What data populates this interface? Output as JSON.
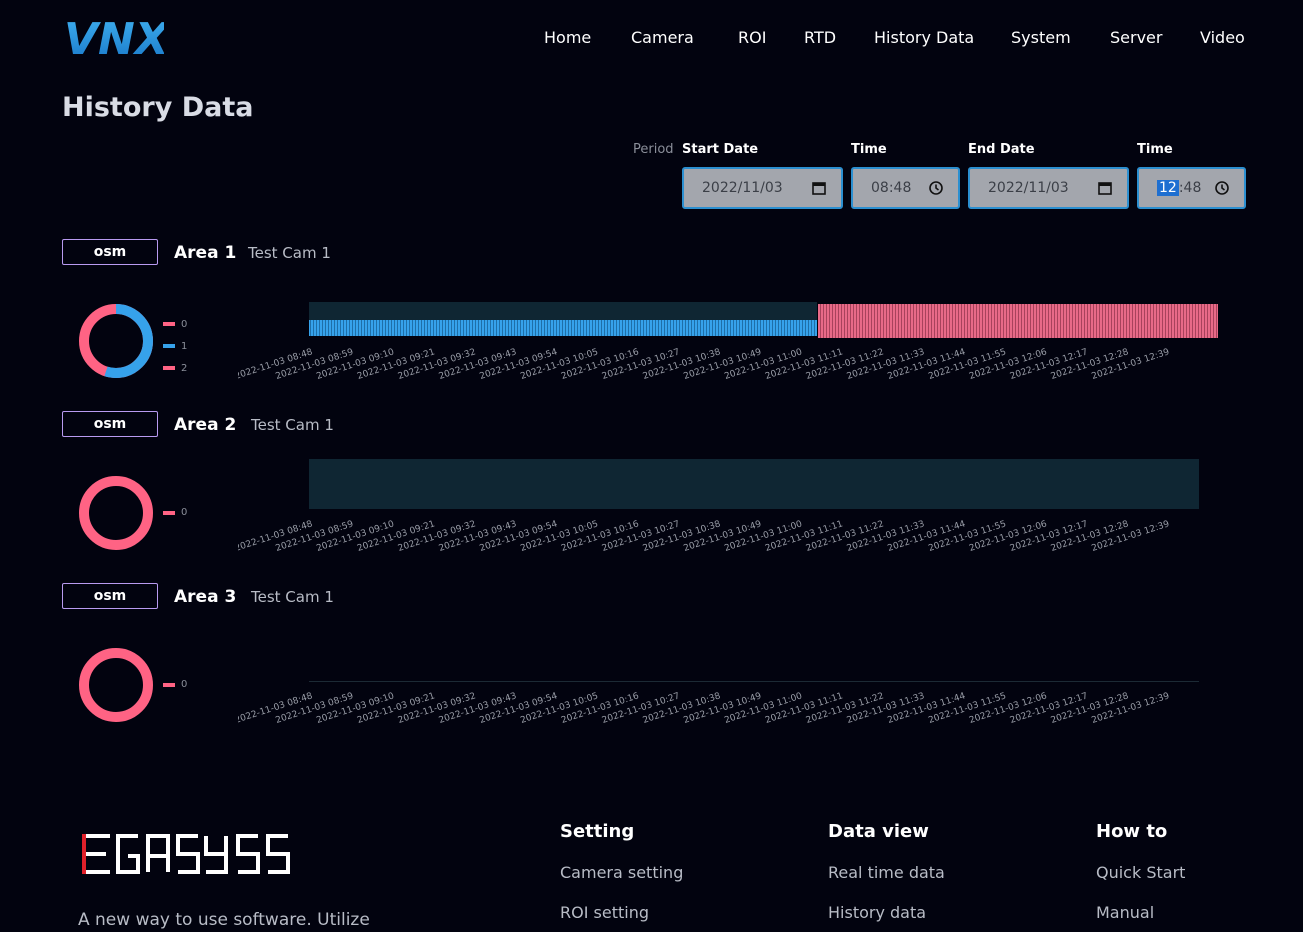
{
  "brand": {
    "logo_text": "VNX",
    "color": "#1a8fd8"
  },
  "nav": {
    "items": [
      "Home",
      "Camera",
      "ROI",
      "RTD",
      "History Data",
      "System",
      "Server",
      "Video"
    ]
  },
  "page": {
    "title": "History Data"
  },
  "filter": {
    "period_label": "Period",
    "start_date_label": "Start Date",
    "start_date_value": "2022/11/03",
    "start_time_label": "Time",
    "start_time_value": "08:48",
    "end_date_label": "End Date",
    "end_date_value": "2022/11/03",
    "end_time_label": "Time",
    "end_time_hour": "12",
    "end_time_rest": ":48"
  },
  "colors": {
    "pink": "#ff6384",
    "blue": "#36a2eb",
    "bar_bg": "#0f2633",
    "badge_border": "#b89af0"
  },
  "x_ticks": [
    "2022-11-03 08:48",
    "2022-11-03 08:59",
    "2022-11-03 09:10",
    "2022-11-03 09:21",
    "2022-11-03 09:32",
    "2022-11-03 09:43",
    "2022-11-03 09:54",
    "2022-11-03 10:05",
    "2022-11-03 10:16",
    "2022-11-03 10:27",
    "2022-11-03 10:38",
    "2022-11-03 10:49",
    "2022-11-03 11:00",
    "2022-11-03 11:11",
    "2022-11-03 11:22",
    "2022-11-03 11:33",
    "2022-11-03 11:44",
    "2022-11-03 11:55",
    "2022-11-03 12:06",
    "2022-11-03 12:17",
    "2022-11-03 12:28",
    "2022-11-03 12:39"
  ],
  "areas": [
    {
      "badge": "osm",
      "name": "Area 1",
      "camera": "Test Cam 1",
      "legend": [
        {
          "label": "0",
          "color": "#ff6384"
        },
        {
          "label": "1",
          "color": "#36a2eb"
        },
        {
          "label": "2",
          "color": "#ff6384"
        }
      ],
      "donut": [
        {
          "value": 0.45,
          "color": "#ff6384"
        },
        {
          "value": 0.55,
          "color": "#36a2eb"
        }
      ]
    },
    {
      "badge": "osm",
      "name": "Area 2",
      "camera": "Test Cam 1",
      "legend": [
        {
          "label": "0",
          "color": "#ff6384"
        }
      ],
      "donut": [
        {
          "value": 1,
          "color": "#ff6384"
        }
      ]
    },
    {
      "badge": "osm",
      "name": "Area 3",
      "camera": "Test Cam 1",
      "legend": [
        {
          "label": "0",
          "color": "#ff6384"
        }
      ],
      "donut": [
        {
          "value": 1,
          "color": "#ff6384"
        }
      ]
    }
  ],
  "footer": {
    "brand": "EGASYS",
    "tagline": "A new way to use software. Utilize",
    "columns": [
      {
        "heading": "Setting",
        "links": [
          "Camera setting",
          "ROI setting"
        ]
      },
      {
        "heading": "Data view",
        "links": [
          "Real time data",
          "History data"
        ]
      },
      {
        "heading": "How to",
        "links": [
          "Quick Start",
          "Manual"
        ]
      }
    ]
  }
}
